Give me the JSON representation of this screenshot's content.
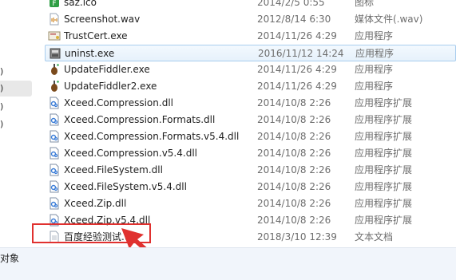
{
  "left_pane": {
    "items": [
      {
        "label": ")"
      },
      {
        "label": ")"
      },
      {
        "label": ")"
      },
      {
        "label": ")"
      }
    ]
  },
  "files": [
    {
      "name": "saz.ico",
      "date": "2014/2/5 0:55",
      "type": "图标",
      "icon": "ico-file-icon"
    },
    {
      "name": "Screenshot.wav",
      "date": "2012/8/14 6:30",
      "type": "媒体文件(.wav)",
      "icon": "audio-file-icon"
    },
    {
      "name": "TrustCert.exe",
      "date": "2014/11/26 4:29",
      "type": "应用程序",
      "icon": "certificate-app-icon"
    },
    {
      "name": "uninst.exe",
      "date": "2016/11/12 14:24",
      "type": "应用程序",
      "icon": "installer-app-icon"
    },
    {
      "name": "UpdateFiddler.exe",
      "date": "2014/11/26 4:29",
      "type": "应用程序",
      "icon": "fiddler-app-icon"
    },
    {
      "name": "UpdateFiddler2.exe",
      "date": "2014/11/26 4:29",
      "type": "应用程序",
      "icon": "fiddler-app-icon"
    },
    {
      "name": "Xceed.Compression.dll",
      "date": "2014/10/8 2:26",
      "type": "应用程序扩展",
      "icon": "dll-file-icon"
    },
    {
      "name": "Xceed.Compression.Formats.dll",
      "date": "2014/10/8 2:26",
      "type": "应用程序扩展",
      "icon": "dll-file-icon"
    },
    {
      "name": "Xceed.Compression.Formats.v5.4.dll",
      "date": "2014/10/8 2:26",
      "type": "应用程序扩展",
      "icon": "dll-file-icon"
    },
    {
      "name": "Xceed.Compression.v5.4.dll",
      "date": "2014/10/8 2:26",
      "type": "应用程序扩展",
      "icon": "dll-file-icon"
    },
    {
      "name": "Xceed.FileSystem.dll",
      "date": "2014/10/8 2:26",
      "type": "应用程序扩展",
      "icon": "dll-file-icon"
    },
    {
      "name": "Xceed.FileSystem.v5.4.dll",
      "date": "2014/10/8 2:26",
      "type": "应用程序扩展",
      "icon": "dll-file-icon"
    },
    {
      "name": "Xceed.Zip.dll",
      "date": "2014/10/8 2:26",
      "type": "应用程序扩展",
      "icon": "dll-file-icon"
    },
    {
      "name": "Xceed.Zip.v5.4.dll",
      "date": "2014/10/8 2:26",
      "type": "应用程序扩展",
      "icon": "dll-file-icon"
    },
    {
      "name": "百度经验测试.txt",
      "date": "2018/3/10 12:39",
      "type": "文本文档",
      "icon": "text-file-icon"
    }
  ],
  "status_bar": {
    "text": "对象"
  },
  "colors": {
    "highlight": "#e0312f",
    "hover_border": "#a9cdee"
  }
}
